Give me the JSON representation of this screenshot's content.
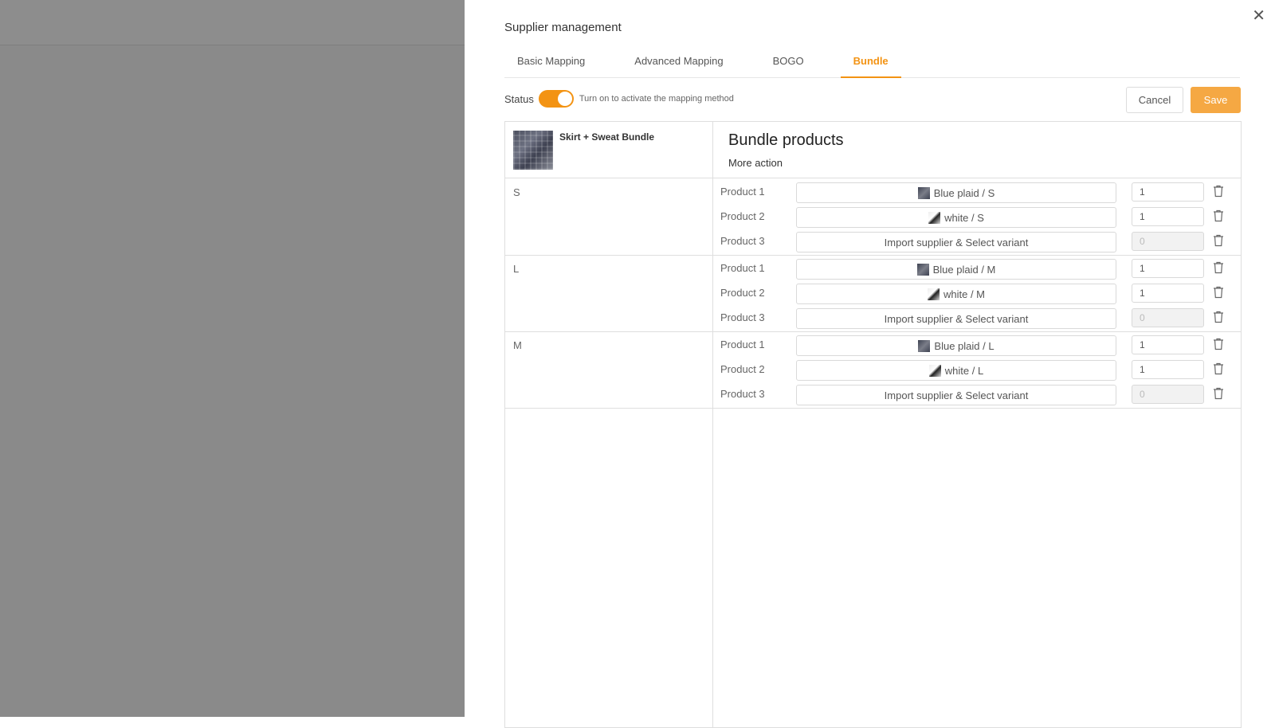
{
  "drawer": {
    "title": "Supplier management",
    "close_icon": "close-icon",
    "tabs": [
      {
        "label": "Basic Mapping",
        "active": false
      },
      {
        "label": "Advanced Mapping",
        "active": false
      },
      {
        "label": "BOGO",
        "active": false
      },
      {
        "label": "Bundle",
        "active": true
      }
    ],
    "status": {
      "label": "Status",
      "enabled": true,
      "hint": "Turn on to activate the mapping method"
    },
    "cancel_label": "Cancel",
    "save_label": "Save",
    "accent_color": "#f39313"
  },
  "bundle": {
    "name": "Skirt + Sweat Bundle",
    "products_title": "Bundle products",
    "more_action": "More action",
    "variants": [
      {
        "label": "S",
        "products": [
          {
            "label": "Product 1",
            "variant": "Blue plaid / S",
            "thumb": "plaid",
            "qty": "1",
            "disabled": false
          },
          {
            "label": "Product 2",
            "variant": "white / S",
            "thumb": "white",
            "qty": "1",
            "disabled": false
          },
          {
            "label": "Product 3",
            "variant": "Import supplier & Select variant",
            "thumb": "",
            "qty": "0",
            "disabled": true
          }
        ]
      },
      {
        "label": "L",
        "products": [
          {
            "label": "Product 1",
            "variant": "Blue plaid / M",
            "thumb": "plaid",
            "qty": "1",
            "disabled": false
          },
          {
            "label": "Product 2",
            "variant": "white / M",
            "thumb": "white",
            "qty": "1",
            "disabled": false
          },
          {
            "label": "Product 3",
            "variant": "Import supplier & Select variant",
            "thumb": "",
            "qty": "0",
            "disabled": true
          }
        ]
      },
      {
        "label": "M",
        "products": [
          {
            "label": "Product 1",
            "variant": "Blue plaid / L",
            "thumb": "plaid",
            "qty": "1",
            "disabled": false
          },
          {
            "label": "Product 2",
            "variant": "white / L",
            "thumb": "white",
            "qty": "1",
            "disabled": false
          },
          {
            "label": "Product 3",
            "variant": "Import supplier & Select variant",
            "thumb": "",
            "qty": "0",
            "disabled": true
          }
        ]
      }
    ]
  }
}
